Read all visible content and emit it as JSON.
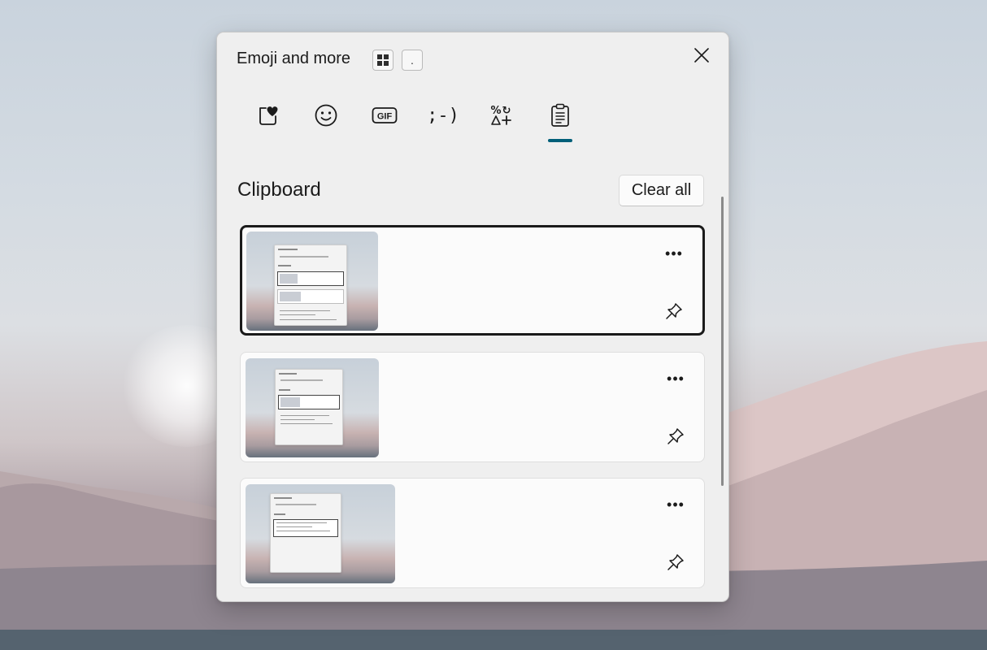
{
  "panel": {
    "title": "Emoji and more",
    "keys": [
      {
        "icon": "windows-logo-icon",
        "label": ""
      },
      {
        "icon": "period-key",
        "label": "."
      }
    ],
    "close_icon": "close-icon"
  },
  "tabs": [
    {
      "name": "favorites",
      "icon": "heart-sticker-icon",
      "label": ""
    },
    {
      "name": "emoji",
      "icon": "smiley-icon",
      "label": ""
    },
    {
      "name": "gif",
      "icon": "gif-icon",
      "label": "GIF"
    },
    {
      "name": "kaomoji",
      "icon": "kaomoji-icon",
      "label": ";-)"
    },
    {
      "name": "symbols",
      "icon": "symbols-icon",
      "label": ""
    },
    {
      "name": "clipboard",
      "icon": "clipboard-icon",
      "label": "",
      "active": true
    }
  ],
  "clipboard": {
    "title": "Clipboard",
    "clear_all": "Clear all",
    "items": [
      {
        "type": "image",
        "selected": true,
        "more_label": "•••",
        "pin_icon": "pin-icon"
      },
      {
        "type": "image",
        "selected": false,
        "more_label": "•••",
        "pin_icon": "pin-icon"
      },
      {
        "type": "image",
        "selected": false,
        "more_label": "•••",
        "pin_icon": "pin-icon"
      }
    ]
  },
  "colors": {
    "accent": "#005f79",
    "panel_bg": "#efefef",
    "card_bg": "#fbfbfb"
  }
}
